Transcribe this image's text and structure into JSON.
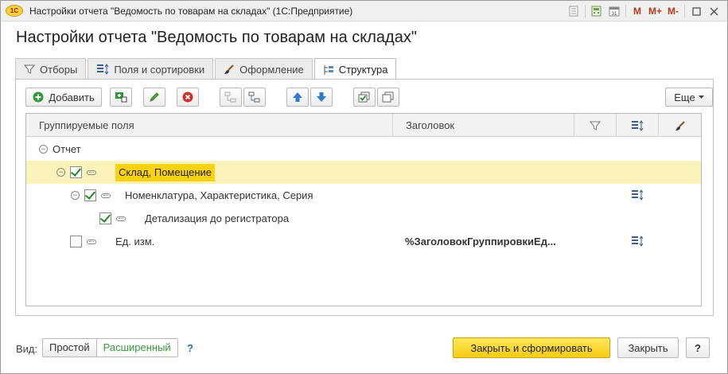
{
  "window": {
    "app_logo": "1С",
    "title": "Настройки отчета \"Ведомость по товарам на складах\"  (1С:Предприятие)",
    "titlebar_buttons": [
      "M",
      "M+",
      "M-"
    ]
  },
  "form": {
    "title": "Настройки отчета \"Ведомость по товарам на складах\""
  },
  "tabs": [
    {
      "label": "Отборы",
      "icon": "filter-icon"
    },
    {
      "label": "Поля и сортировки",
      "icon": "sort-icon"
    },
    {
      "label": "Оформление",
      "icon": "brush-icon"
    },
    {
      "label": "Структура",
      "icon": "structure-icon",
      "active": true
    }
  ],
  "toolbar": {
    "add_label": "Добавить",
    "more_label": "Еще",
    "icons": [
      "add-group-icon",
      "edit-icon",
      "delete-icon",
      "move-in-icon",
      "move-out-icon",
      "move-up-icon",
      "move-down-icon",
      "check-all-icon",
      "copy-icon"
    ]
  },
  "table": {
    "columns": [
      "Группируемые поля",
      "Заголовок"
    ],
    "column_icons": [
      "filter-icon",
      "sort-icon",
      "brush-icon"
    ],
    "rows": [
      {
        "name": "Отчет",
        "title": "",
        "checked": null,
        "collapsible": true,
        "sort_icon": false
      },
      {
        "name": "Склад, Помещение",
        "title": "",
        "checked": true,
        "collapsible": true,
        "selected": true,
        "sort_icon": false
      },
      {
        "name": "Номенклатура, Характеристика, Серия",
        "title": "",
        "checked": true,
        "collapsible": true,
        "sort_icon": true
      },
      {
        "name": "Детализация до регистратора",
        "title": "",
        "checked": true,
        "collapsible": false,
        "sort_icon": false
      },
      {
        "name": "Ед. изм.",
        "title": "%ЗаголовокГруппировкиЕд...",
        "checked": false,
        "collapsible": false,
        "sort_icon": true
      }
    ]
  },
  "footer": {
    "view_label": "Вид:",
    "view_options": [
      "Простой",
      "Расширенный"
    ],
    "selected_view": "Расширенный",
    "help_link": "?",
    "primary_button": "Закрыть и сформировать",
    "close_button": "Закрыть",
    "help_button": "?"
  },
  "colors": {
    "selection_row": "#fbf3b9",
    "selection_highlight": "#fbd20b",
    "primary_button": "#f6cc12",
    "accent_green": "#3a9a3a"
  }
}
